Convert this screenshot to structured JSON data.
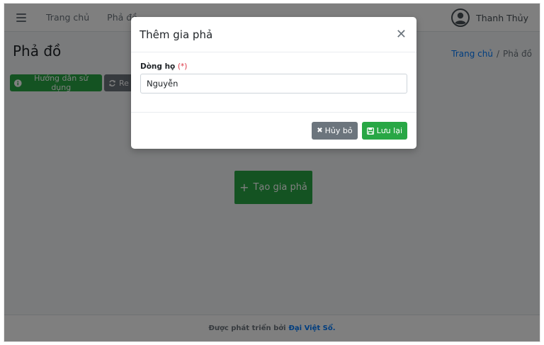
{
  "navbar": {
    "links": [
      "Trang chủ",
      "Phả đồ"
    ],
    "user_name": "Thanh Thủy"
  },
  "page": {
    "title": "Phả đồ",
    "breadcrumb": {
      "home": "Trang chủ",
      "separator": "/",
      "current": "Phả đồ"
    }
  },
  "toolbar": {
    "guide_label": "Hướng dẫn sử dụng",
    "reset_label": "Re"
  },
  "main": {
    "create_label": "Tạo gia phả"
  },
  "footer": {
    "prefix": "Được phát triển bởi",
    "brand": "Đại Việt Sổ."
  },
  "modal": {
    "title": "Thêm gia phả",
    "field_label": "Dòng họ",
    "required_mark": "(*)",
    "field_value": "Nguyễn",
    "cancel_label": "Hủy bỏ",
    "save_label": "Lưu lại"
  },
  "icons": {
    "menu": "hamburger-icon",
    "user": "user-circle-icon",
    "info": "info-circle-icon",
    "reset": "refresh-icon",
    "plus": "plus-icon",
    "close": "close-icon",
    "cancel": "times-icon",
    "save": "floppy-disk-icon"
  },
  "colors": {
    "primary": "#007bff",
    "success": "#28a745",
    "secondary": "#6c757d",
    "danger": "#dc3545"
  }
}
